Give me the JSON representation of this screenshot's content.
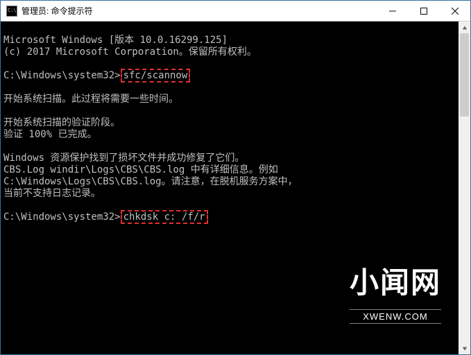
{
  "titlebar": {
    "title": "管理员: 命令提示符"
  },
  "terminal": {
    "line1": "Microsoft Windows [版本 10.0.16299.125]",
    "line2": "(c) 2017 Microsoft Corporation。保留所有权利。",
    "prompt1_prefix": "C:\\Windows\\system32>",
    "prompt1_cmd": "sfc/scannow",
    "line3": "开始系统扫描。此过程将需要一些时间。",
    "line4": "开始系统扫描的验证阶段。",
    "line5": "验证 100% 已完成。",
    "line6": "Windows 资源保护找到了损坏文件并成功修复了它们。",
    "line7": "CBS.Log windir\\Logs\\CBS\\CBS.log 中有详细信息。例如",
    "line8": "C:\\Windows\\Logs\\CBS\\CBS.log。请注意，在脱机服务方案中，",
    "line9": "当前不支持日志记录。",
    "prompt2_prefix": "C:\\Windows\\system32>",
    "prompt2_cmd": "chkdsk c: /f/r"
  },
  "watermark": {
    "big": "小闻网",
    "small": "XWENW.COM"
  }
}
